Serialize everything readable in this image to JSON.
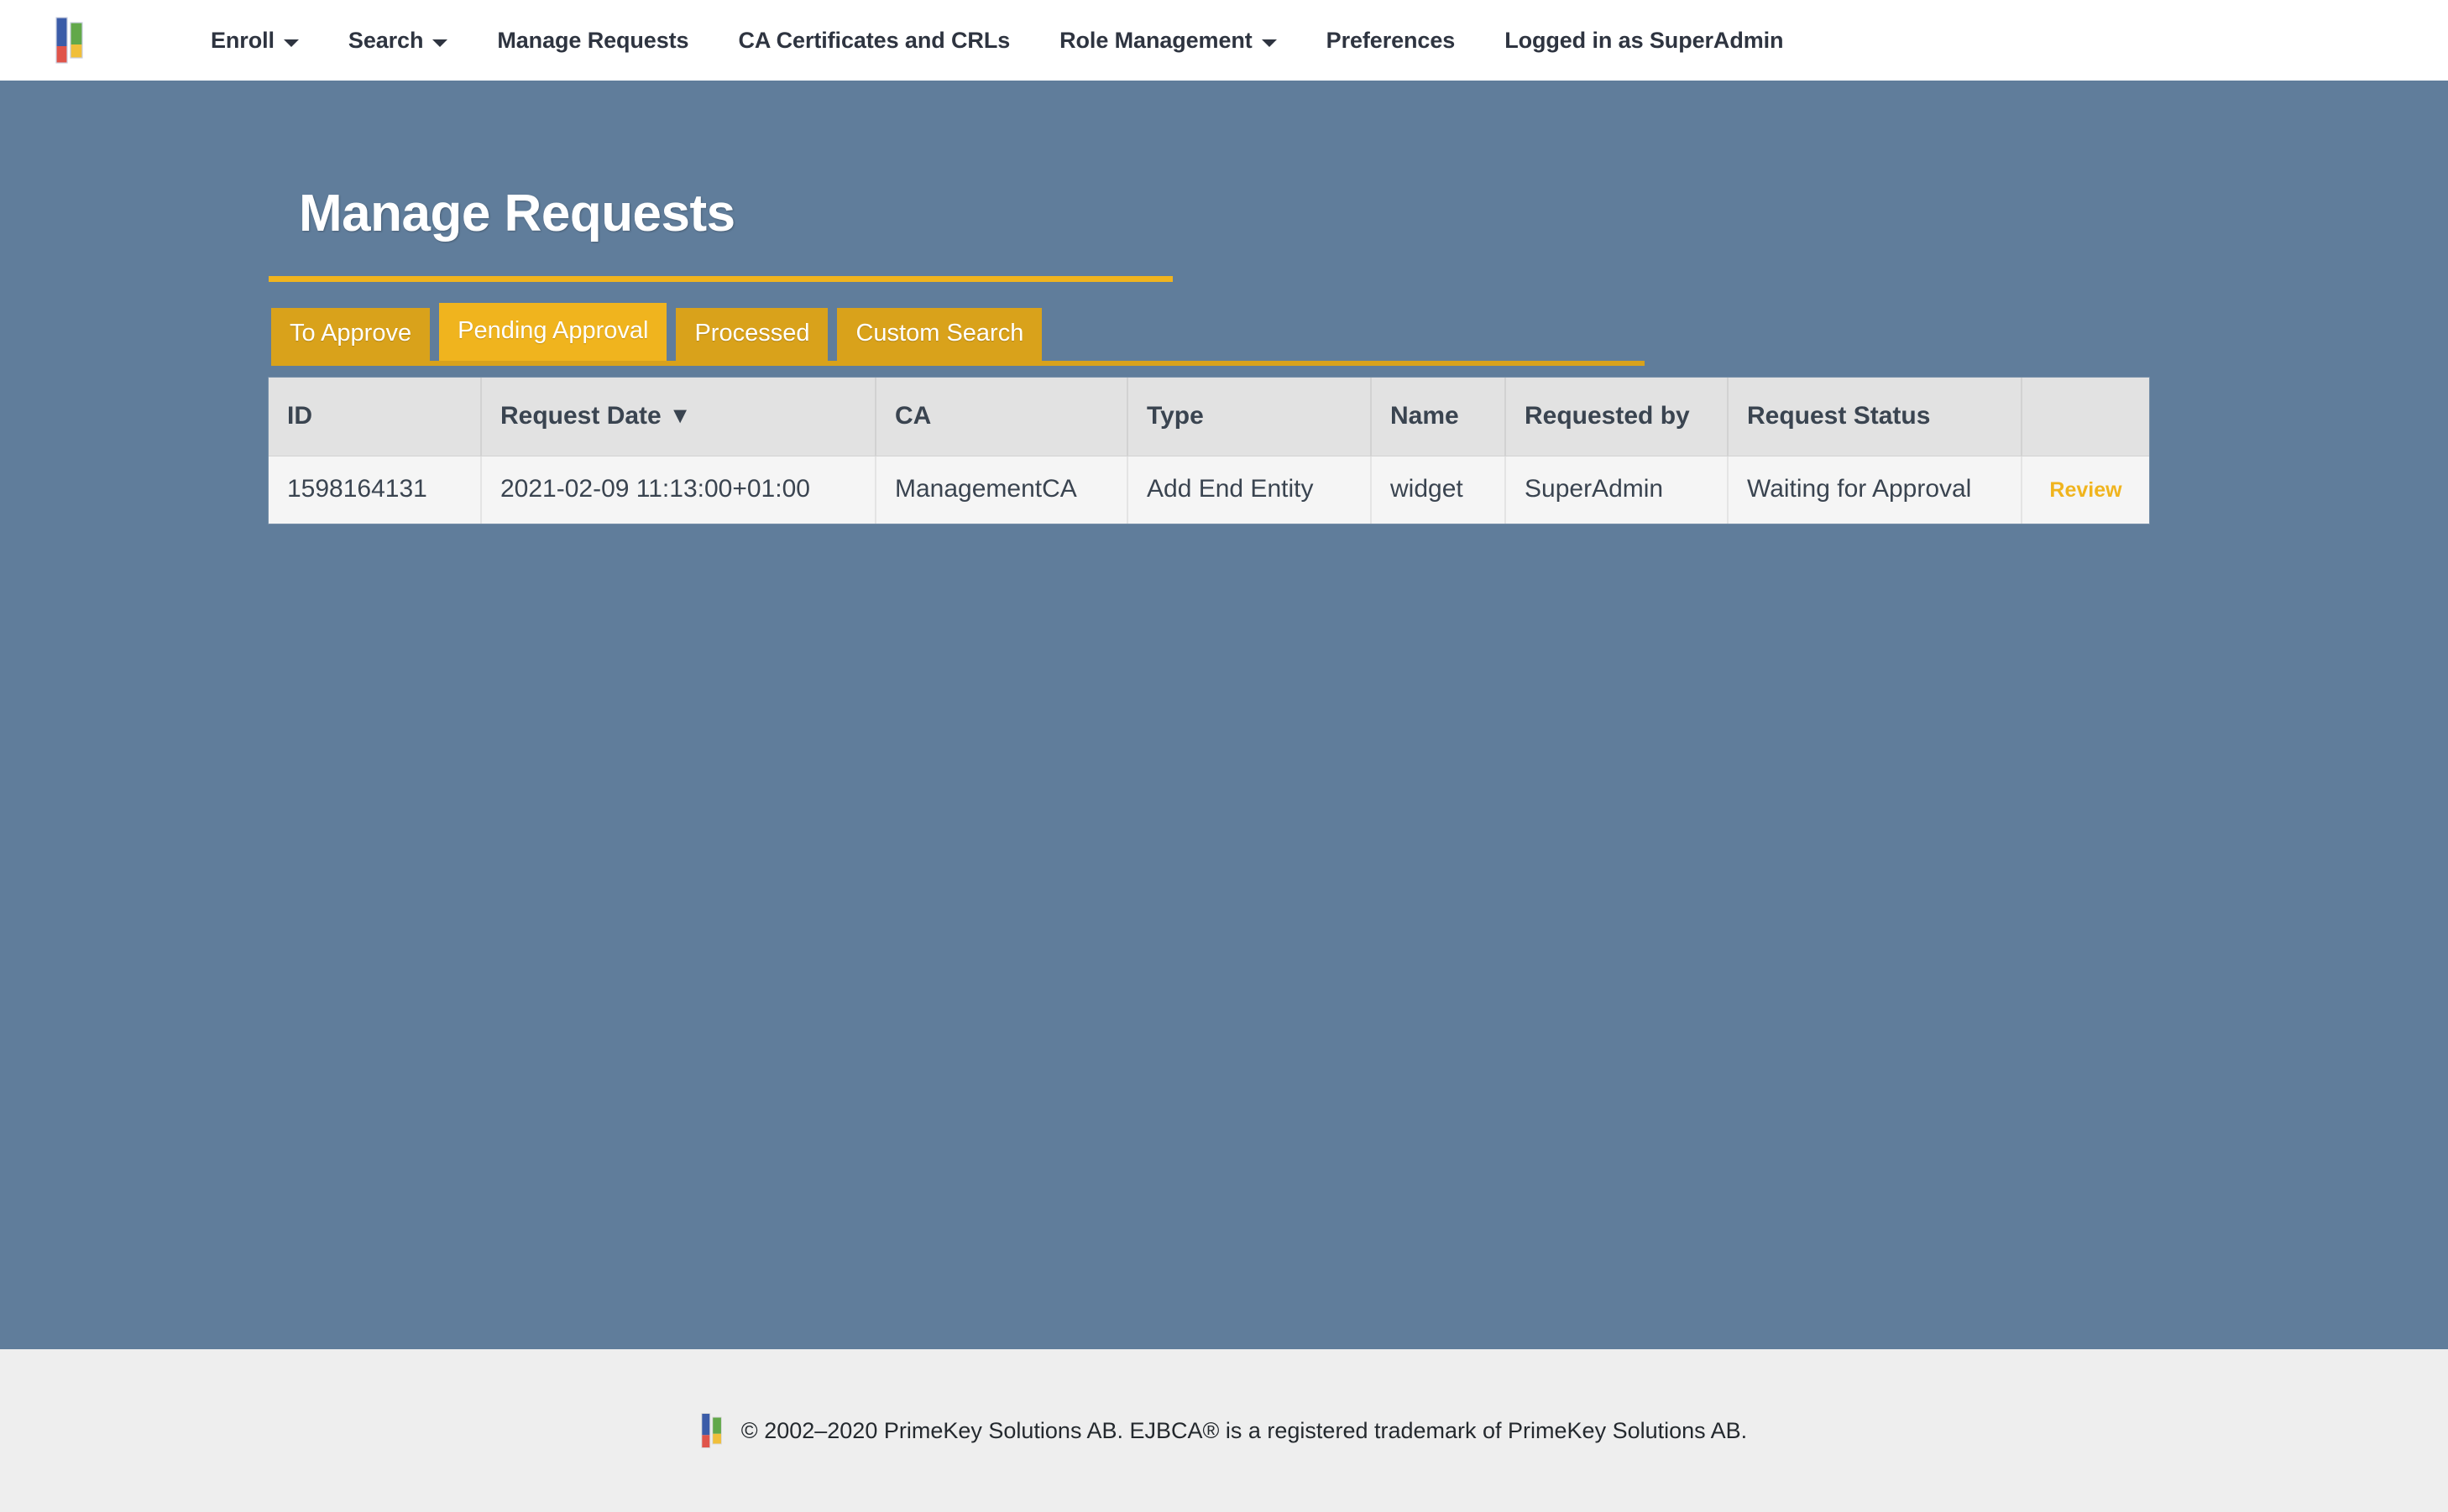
{
  "nav": {
    "logo_icon": "primekey-logo-icon",
    "items": [
      {
        "label": "Enroll",
        "has_caret": true
      },
      {
        "label": "Search",
        "has_caret": true
      },
      {
        "label": "Manage Requests",
        "has_caret": false
      },
      {
        "label": "CA Certificates and CRLs",
        "has_caret": false
      },
      {
        "label": "Role Management",
        "has_caret": true
      },
      {
        "label": "Preferences",
        "has_caret": false
      },
      {
        "label": "Logged in as SuperAdmin",
        "has_caret": false
      }
    ]
  },
  "main": {
    "title": "Manage Requests",
    "tabs": [
      {
        "label": "To Approve",
        "active": false
      },
      {
        "label": "Pending Approval",
        "active": true
      },
      {
        "label": "Processed",
        "active": false
      },
      {
        "label": "Custom Search",
        "active": false
      }
    ],
    "table": {
      "columns": [
        {
          "label": "ID",
          "sort": ""
        },
        {
          "label": "Request Date",
          "sort": "▼"
        },
        {
          "label": "CA",
          "sort": ""
        },
        {
          "label": "Type",
          "sort": ""
        },
        {
          "label": "Name",
          "sort": ""
        },
        {
          "label": "Requested by",
          "sort": ""
        },
        {
          "label": "Request Status",
          "sort": ""
        },
        {
          "label": "",
          "sort": ""
        }
      ],
      "rows": [
        {
          "id": "1598164131",
          "request_date": "2021-02-09 11:13:00+01:00",
          "ca": "ManagementCA",
          "type": "Add End Entity",
          "name": "widget",
          "requested_by": "SuperAdmin",
          "request_status": "Waiting for Approval",
          "action": "Review"
        }
      ]
    }
  },
  "footer": {
    "logo_icon": "primekey-logo-icon",
    "copyright": "© 2002–2020 PrimeKey Solutions AB. EJBCA® is a registered trademark of PrimeKey Solutions AB."
  },
  "colors": {
    "page_background": "#607d9b",
    "navbar_background": "#ffffff",
    "accent_gold": "#f0b41e",
    "tab_gold": "#d9a21b",
    "footer_background": "#eeeeee",
    "table_header": "#e2e2e2",
    "table_cell": "#f5f5f5",
    "text_dark": "#3a4450"
  }
}
